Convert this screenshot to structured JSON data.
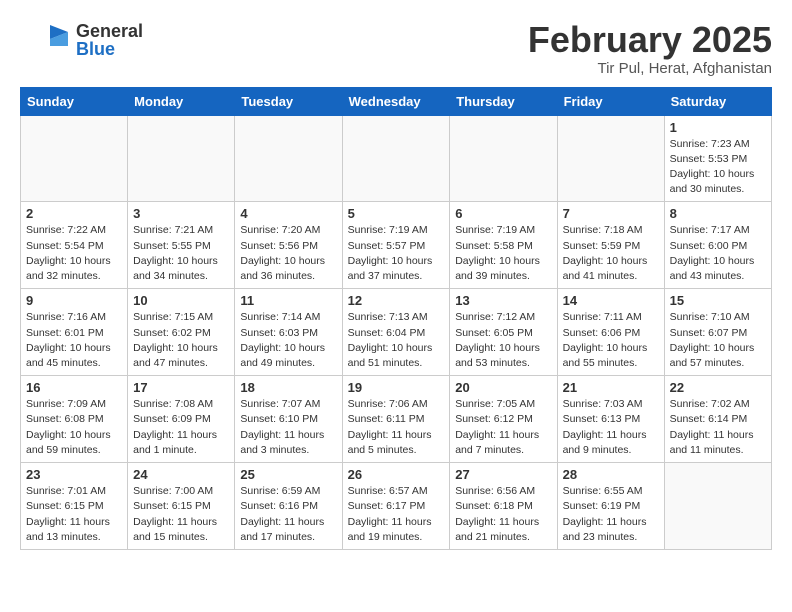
{
  "header": {
    "logo_general": "General",
    "logo_blue": "Blue",
    "month": "February 2025",
    "location": "Tir Pul, Herat, Afghanistan"
  },
  "weekdays": [
    "Sunday",
    "Monday",
    "Tuesday",
    "Wednesday",
    "Thursday",
    "Friday",
    "Saturday"
  ],
  "weeks": [
    [
      {
        "day": "",
        "info": ""
      },
      {
        "day": "",
        "info": ""
      },
      {
        "day": "",
        "info": ""
      },
      {
        "day": "",
        "info": ""
      },
      {
        "day": "",
        "info": ""
      },
      {
        "day": "",
        "info": ""
      },
      {
        "day": "1",
        "info": "Sunrise: 7:23 AM\nSunset: 5:53 PM\nDaylight: 10 hours and 30 minutes."
      }
    ],
    [
      {
        "day": "2",
        "info": "Sunrise: 7:22 AM\nSunset: 5:54 PM\nDaylight: 10 hours and 32 minutes."
      },
      {
        "day": "3",
        "info": "Sunrise: 7:21 AM\nSunset: 5:55 PM\nDaylight: 10 hours and 34 minutes."
      },
      {
        "day": "4",
        "info": "Sunrise: 7:20 AM\nSunset: 5:56 PM\nDaylight: 10 hours and 36 minutes."
      },
      {
        "day": "5",
        "info": "Sunrise: 7:19 AM\nSunset: 5:57 PM\nDaylight: 10 hours and 37 minutes."
      },
      {
        "day": "6",
        "info": "Sunrise: 7:19 AM\nSunset: 5:58 PM\nDaylight: 10 hours and 39 minutes."
      },
      {
        "day": "7",
        "info": "Sunrise: 7:18 AM\nSunset: 5:59 PM\nDaylight: 10 hours and 41 minutes."
      },
      {
        "day": "8",
        "info": "Sunrise: 7:17 AM\nSunset: 6:00 PM\nDaylight: 10 hours and 43 minutes."
      }
    ],
    [
      {
        "day": "9",
        "info": "Sunrise: 7:16 AM\nSunset: 6:01 PM\nDaylight: 10 hours and 45 minutes."
      },
      {
        "day": "10",
        "info": "Sunrise: 7:15 AM\nSunset: 6:02 PM\nDaylight: 10 hours and 47 minutes."
      },
      {
        "day": "11",
        "info": "Sunrise: 7:14 AM\nSunset: 6:03 PM\nDaylight: 10 hours and 49 minutes."
      },
      {
        "day": "12",
        "info": "Sunrise: 7:13 AM\nSunset: 6:04 PM\nDaylight: 10 hours and 51 minutes."
      },
      {
        "day": "13",
        "info": "Sunrise: 7:12 AM\nSunset: 6:05 PM\nDaylight: 10 hours and 53 minutes."
      },
      {
        "day": "14",
        "info": "Sunrise: 7:11 AM\nSunset: 6:06 PM\nDaylight: 10 hours and 55 minutes."
      },
      {
        "day": "15",
        "info": "Sunrise: 7:10 AM\nSunset: 6:07 PM\nDaylight: 10 hours and 57 minutes."
      }
    ],
    [
      {
        "day": "16",
        "info": "Sunrise: 7:09 AM\nSunset: 6:08 PM\nDaylight: 10 hours and 59 minutes."
      },
      {
        "day": "17",
        "info": "Sunrise: 7:08 AM\nSunset: 6:09 PM\nDaylight: 11 hours and 1 minute."
      },
      {
        "day": "18",
        "info": "Sunrise: 7:07 AM\nSunset: 6:10 PM\nDaylight: 11 hours and 3 minutes."
      },
      {
        "day": "19",
        "info": "Sunrise: 7:06 AM\nSunset: 6:11 PM\nDaylight: 11 hours and 5 minutes."
      },
      {
        "day": "20",
        "info": "Sunrise: 7:05 AM\nSunset: 6:12 PM\nDaylight: 11 hours and 7 minutes."
      },
      {
        "day": "21",
        "info": "Sunrise: 7:03 AM\nSunset: 6:13 PM\nDaylight: 11 hours and 9 minutes."
      },
      {
        "day": "22",
        "info": "Sunrise: 7:02 AM\nSunset: 6:14 PM\nDaylight: 11 hours and 11 minutes."
      }
    ],
    [
      {
        "day": "23",
        "info": "Sunrise: 7:01 AM\nSunset: 6:15 PM\nDaylight: 11 hours and 13 minutes."
      },
      {
        "day": "24",
        "info": "Sunrise: 7:00 AM\nSunset: 6:15 PM\nDaylight: 11 hours and 15 minutes."
      },
      {
        "day": "25",
        "info": "Sunrise: 6:59 AM\nSunset: 6:16 PM\nDaylight: 11 hours and 17 minutes."
      },
      {
        "day": "26",
        "info": "Sunrise: 6:57 AM\nSunset: 6:17 PM\nDaylight: 11 hours and 19 minutes."
      },
      {
        "day": "27",
        "info": "Sunrise: 6:56 AM\nSunset: 6:18 PM\nDaylight: 11 hours and 21 minutes."
      },
      {
        "day": "28",
        "info": "Sunrise: 6:55 AM\nSunset: 6:19 PM\nDaylight: 11 hours and 23 minutes."
      },
      {
        "day": "",
        "info": ""
      }
    ]
  ]
}
